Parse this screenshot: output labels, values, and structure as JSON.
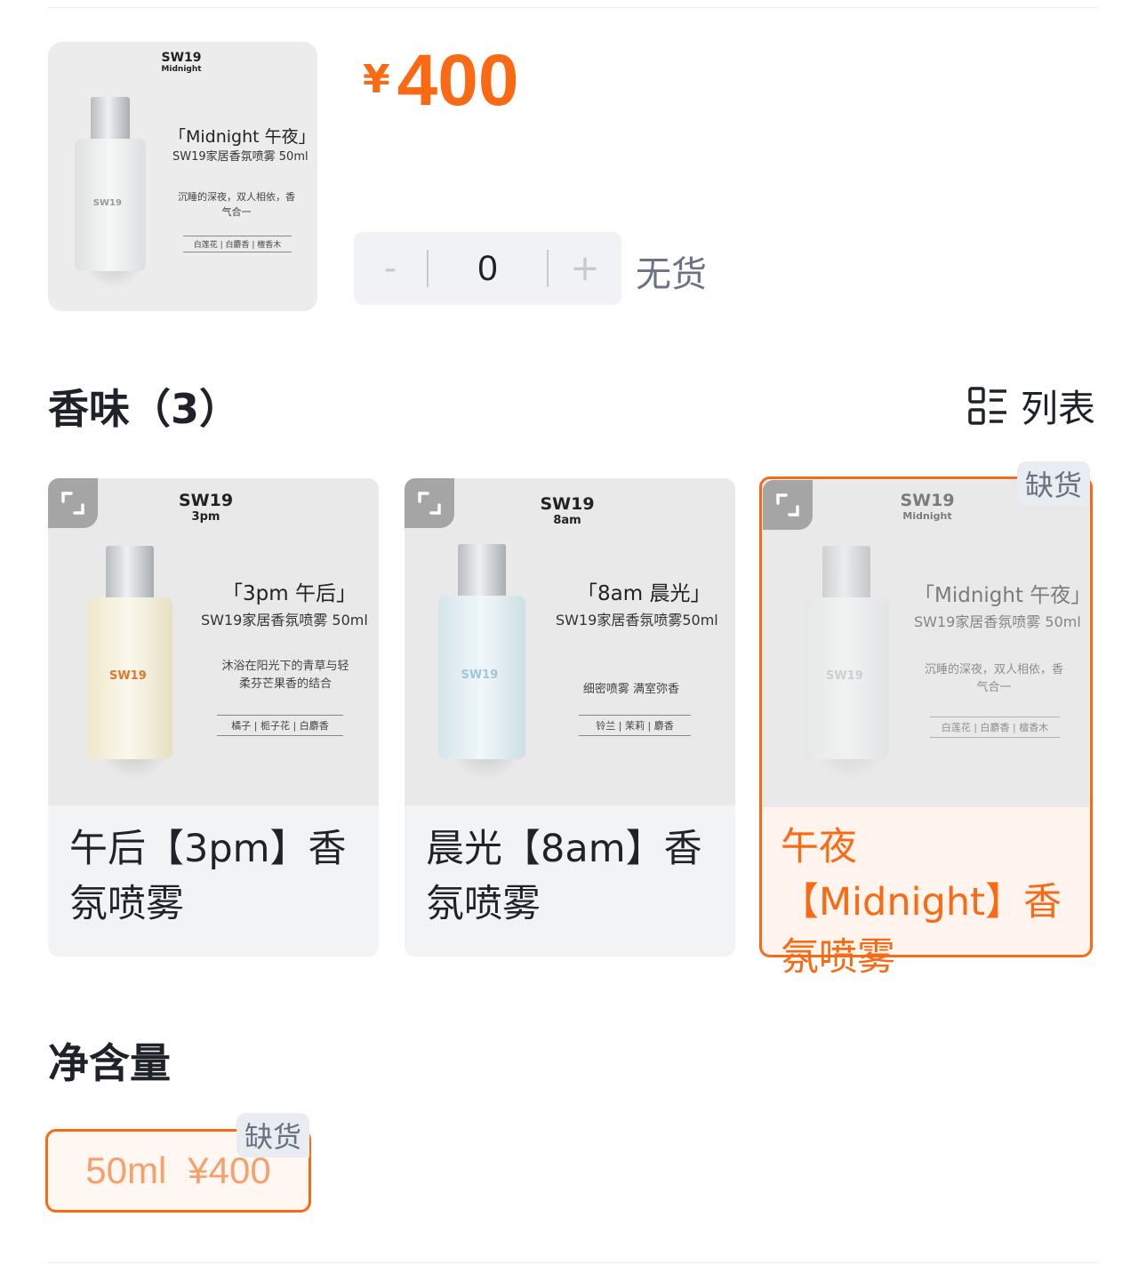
{
  "product": {
    "price_currency": "¥",
    "price_value": "400",
    "thumb": {
      "brand": "SW19",
      "edition": "Midnight",
      "title": "「Midnight 午夜」",
      "subtitle": "SW19家居香氛喷雾 50ml",
      "desc": "沉睡的深夜，双人相依，香气合一",
      "notes": "白莲花 | 白麝香 | 檀香木",
      "bottle_label": "SW19"
    }
  },
  "stepper": {
    "minus": "-",
    "value": "0",
    "plus": "+"
  },
  "stock_status": "无货",
  "scent_section": {
    "title": "香味（3）",
    "list_toggle_label": "列表",
    "items": [
      {
        "name": "午后【3pm】香氛喷雾",
        "brand": "SW19",
        "edition": "3pm",
        "img_title": "「3pm 午后」",
        "img_subtitle": "SW19家居香氛喷雾 50ml",
        "img_desc": "沐浴在阳光下的青草与轻柔芬芒果香的结合",
        "img_notes": "橘子 | 栀子花 | 白麝香",
        "bottle_label": "SW19",
        "bottle_color": "#f6f1df",
        "accent": "#e2782c"
      },
      {
        "name": "晨光【8am】香氛喷雾",
        "brand": "SW19",
        "edition": "8am",
        "img_title": "「8am 晨光」",
        "img_subtitle": "SW19家居香氛喷雾50ml",
        "img_desc": "细密喷雾 满室弥香",
        "img_notes": "铃兰 | 茉莉 | 麝香",
        "bottle_label": "SW19",
        "bottle_color": "#e4eef2",
        "accent": "#9fc7d8"
      },
      {
        "name": "午夜【Midnight】香氛喷雾",
        "brand": "SW19",
        "edition": "Midnight",
        "img_title": "「Midnight 午夜」",
        "img_subtitle": "SW19家居香氛喷雾 50ml",
        "img_desc": "沉睡的深夜，双人相依，香气合一",
        "img_notes": "白莲花 | 白麝香 | 檀香木",
        "bottle_label": "SW19",
        "bottle_color": "#f0f2f2",
        "accent": "#c9cccf",
        "badge": "缺货",
        "selected": true
      }
    ]
  },
  "size_section": {
    "title": "净含量",
    "options": [
      {
        "size": "50ml",
        "price": "¥400",
        "badge": "缺货",
        "selected": true
      }
    ]
  },
  "colors": {
    "accent_orange": "#fa6a14",
    "muted_gray": "#6b7380",
    "card_bg": "#f2f3f5"
  }
}
